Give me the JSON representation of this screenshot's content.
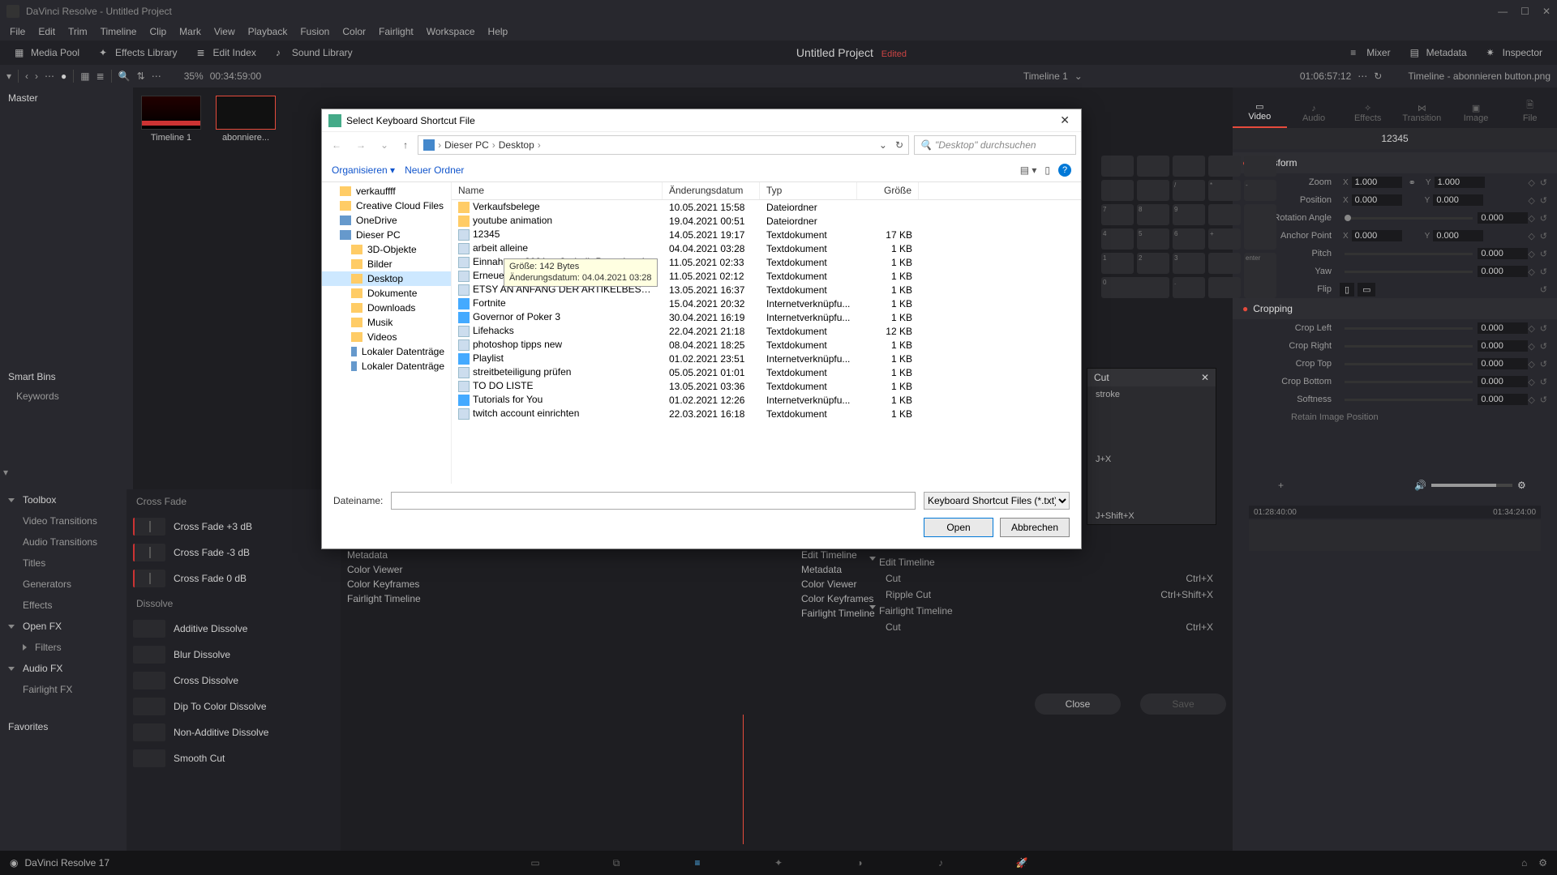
{
  "titlebar": {
    "text": "DaVinci Resolve - Untitled Project"
  },
  "menus": [
    "File",
    "Edit",
    "Trim",
    "Timeline",
    "Clip",
    "Mark",
    "View",
    "Playback",
    "Fusion",
    "Color",
    "Fairlight",
    "Workspace",
    "Help"
  ],
  "toptools": {
    "media_pool": "Media Pool",
    "effects_library": "Effects Library",
    "edit_index": "Edit Index",
    "sound_library": "Sound Library",
    "project_title": "Untitled Project",
    "edited": "Edited",
    "mixer": "Mixer",
    "metadata": "Metadata",
    "inspector": "Inspector"
  },
  "subtool": {
    "zoom_pct": "35%",
    "duration": "00:34:59:00",
    "timeline_label": "Timeline 1",
    "timecode": "01:06:57:12",
    "timeline_right": "Timeline - abonnieren button.png"
  },
  "left": {
    "master": "Master",
    "smartbins": "Smart Bins",
    "keywords": "Keywords"
  },
  "clips": [
    {
      "name": "Timeline 1"
    },
    {
      "name": "abonniere..."
    }
  ],
  "fx_categories": {
    "toolbox": "Toolbox",
    "video_transitions": "Video Transitions",
    "audio_transitions": "Audio Transitions",
    "titles": "Titles",
    "generators": "Generators",
    "effects": "Effects",
    "openfx": "Open FX",
    "filters": "Filters",
    "audiofx": "Audio FX",
    "fairlightfx": "Fairlight FX",
    "favorites": "Favorites"
  },
  "fx_groups": {
    "cross_fade": "Cross Fade",
    "dissolve": "Dissolve"
  },
  "fx_items": {
    "cf3": "Cross Fade +3 dB",
    "cfm3": "Cross Fade -3 dB",
    "cf0": "Cross Fade 0 dB",
    "additive": "Additive Dissolve",
    "blur": "Blur Dissolve",
    "cross": "Cross Dissolve",
    "dip": "Dip To Color Dissolve",
    "nonadd": "Non-Additive Dissolve",
    "smooth": "Smooth Cut"
  },
  "inspector": {
    "tabs": {
      "video": "Video",
      "audio": "Audio",
      "effects": "Effects",
      "transition": "Transition",
      "image": "Image",
      "file": "File"
    },
    "number_label": "12345",
    "transform": "Transform",
    "cropping": "Cropping",
    "rows": {
      "zoom": "Zoom",
      "position": "Position",
      "rotation": "Rotation Angle",
      "anchor": "Anchor Point",
      "pitch": "Pitch",
      "yaw": "Yaw",
      "flip": "Flip",
      "cropl": "Crop Left",
      "cropr": "Crop Right",
      "cropt": "Crop Top",
      "cropb": "Crop Bottom",
      "soft": "Softness",
      "retain": "Retain Image Position"
    },
    "vals": {
      "zoom_x": "1.000",
      "zoom_y": "1.000",
      "pos_x": "0.000",
      "pos_y": "0.000",
      "rot": "0.000",
      "anc_x": "0.000",
      "anc_y": "0.000",
      "pitch": "0.000",
      "yaw": "0.000",
      "cl": "0.000",
      "cr": "0.000",
      "ct": "0.000",
      "cb": "0.000",
      "sf": "0.000"
    }
  },
  "dialog": {
    "title": "Select Keyboard Shortcut File",
    "crumbs": [
      "Dieser PC",
      "Desktop"
    ],
    "search_ph": "\"Desktop\" durchsuchen",
    "organize": "Organisieren",
    "new_folder": "Neuer Ordner",
    "columns": {
      "name": "Name",
      "date": "Änderungsdatum",
      "type": "Typ",
      "size": "Größe"
    },
    "tree": [
      {
        "label": "verkauffff",
        "ico": "f"
      },
      {
        "label": "Creative Cloud Files",
        "ico": "f"
      },
      {
        "label": "OneDrive",
        "ico": "d"
      },
      {
        "label": "Dieser PC",
        "ico": "d"
      },
      {
        "label": "3D-Objekte",
        "ico": "f",
        "indent": true
      },
      {
        "label": "Bilder",
        "ico": "f",
        "indent": true
      },
      {
        "label": "Desktop",
        "ico": "f",
        "indent": true,
        "sel": true
      },
      {
        "label": "Dokumente",
        "ico": "f",
        "indent": true
      },
      {
        "label": "Downloads",
        "ico": "f",
        "indent": true
      },
      {
        "label": "Musik",
        "ico": "f",
        "indent": true
      },
      {
        "label": "Videos",
        "ico": "f",
        "indent": true
      },
      {
        "label": "Lokaler Datenträge",
        "ico": "d",
        "indent": true
      },
      {
        "label": "Lokaler Datenträge",
        "ico": "d",
        "indent": true
      }
    ],
    "rows": [
      {
        "name": "Verkaufsbelege",
        "date": "10.05.2021 15:58",
        "type": "Dateiordner",
        "size": "",
        "ico": "folder"
      },
      {
        "name": "youtube animation",
        "date": "19.04.2021 00:51",
        "type": "Dateiordner",
        "size": "",
        "ico": "folder"
      },
      {
        "name": "12345",
        "date": "14.05.2021 19:17",
        "type": "Textdokument",
        "size": "17 KB",
        "ico": "txt"
      },
      {
        "name": "arbeit alleine",
        "date": "04.04.2021 03:28",
        "type": "Textdokument",
        "size": "1 KB",
        "ico": "txt"
      },
      {
        "name": "Einnahmen 2021 außerhalb Paypal und N...",
        "date": "11.05.2021 02:33",
        "type": "Textdokument",
        "size": "1 KB",
        "ico": "txt"
      },
      {
        "name": "Erneuern WICHTIG",
        "date": "11.05.2021 02:12",
        "type": "Textdokument",
        "size": "1 KB",
        "ico": "txt"
      },
      {
        "name": "ETSY AN ANFANG DER ARTIKELBESCHREI...",
        "date": "13.05.2021 16:37",
        "type": "Textdokument",
        "size": "1 KB",
        "ico": "txt"
      },
      {
        "name": "Fortnite",
        "date": "15.04.2021 20:32",
        "type": "Internetverknüpfu...",
        "size": "1 KB",
        "ico": "url"
      },
      {
        "name": "Governor of Poker 3",
        "date": "30.04.2021 16:19",
        "type": "Internetverknüpfu...",
        "size": "1 KB",
        "ico": "url"
      },
      {
        "name": "Lifehacks",
        "date": "22.04.2021 21:18",
        "type": "Textdokument",
        "size": "12 KB",
        "ico": "txt"
      },
      {
        "name": "photoshop tipps new",
        "date": "08.04.2021 18:25",
        "type": "Textdokument",
        "size": "1 KB",
        "ico": "txt"
      },
      {
        "name": "Playlist",
        "date": "01.02.2021 23:51",
        "type": "Internetverknüpfu...",
        "size": "1 KB",
        "ico": "url"
      },
      {
        "name": "streitbeteiligung prüfen",
        "date": "05.05.2021 01:01",
        "type": "Textdokument",
        "size": "1 KB",
        "ico": "txt"
      },
      {
        "name": "TO DO LISTE",
        "date": "13.05.2021 03:36",
        "type": "Textdokument",
        "size": "1 KB",
        "ico": "txt"
      },
      {
        "name": "Tutorials for You",
        "date": "01.02.2021 12:26",
        "type": "Internetverknüpfu...",
        "size": "1 KB",
        "ico": "url"
      },
      {
        "name": "twitch account einrichten",
        "date": "22.03.2021 16:18",
        "type": "Textdokument",
        "size": "1 KB",
        "ico": "txt"
      }
    ],
    "tooltip_l1": "Größe: 142 Bytes",
    "tooltip_l2": "Änderungsdatum: 04.04.2021 03:28",
    "filename_label": "Dateiname:",
    "filter": "Keyboard Shortcut Files (*.txt)",
    "open": "Open",
    "cancel": "Abbrechen"
  },
  "cut_panel": {
    "title": "Cut",
    "stroke": "stroke",
    "k1": "J+X",
    "k2": "J+Shift+X"
  },
  "kbd_left": [
    "Metadata",
    "Color Viewer",
    "Color Keyframes",
    "Fairlight Timeline"
  ],
  "kbd_mid": [
    "Edit Timeline",
    "Metadata",
    "Color Viewer",
    "Color Keyframes",
    "Fairlight Timeline"
  ],
  "sc": {
    "edit": "Edit Timeline",
    "cut": "Cut",
    "ripple": "Ripple Cut",
    "fair": "Fairlight Timeline",
    "kx": "Ctrl+X",
    "ksx": "Ctrl+Shift+X"
  },
  "close": "Close",
  "save": "Save",
  "timeline": {
    "t1": "01:28:40:00",
    "t2": "01:34:24:00"
  },
  "footer": {
    "app": "DaVinci Resolve 17"
  },
  "keylabels": [
    "",
    "",
    "",
    "",
    "",
    "",
    "",
    "/",
    "*",
    "-",
    "7",
    "8",
    "9",
    "",
    "4",
    "5",
    "6",
    "+",
    "1",
    "2",
    "3",
    "",
    "0",
    "",
    ".",
    "enter"
  ]
}
